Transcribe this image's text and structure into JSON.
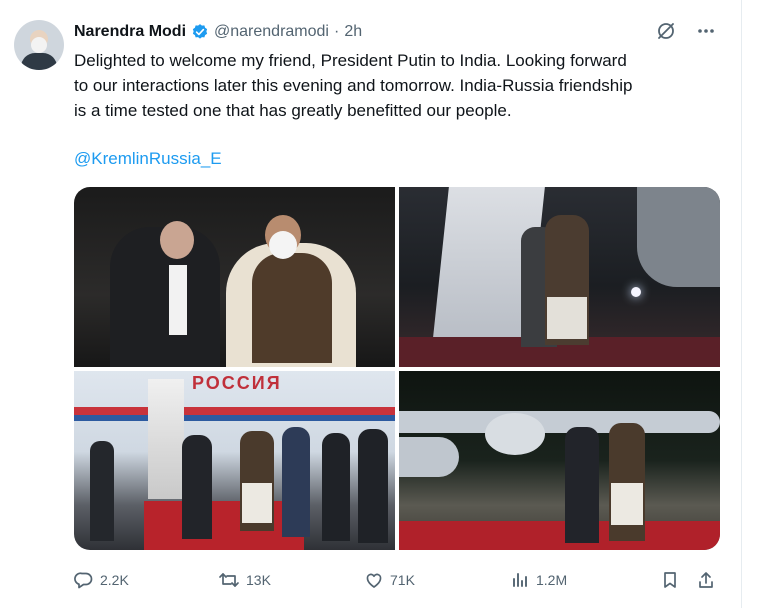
{
  "tweet": {
    "author_name": "Narendra Modi",
    "handle": "@narendramodi",
    "separator": "·",
    "time": "2h",
    "text": "Delighted to welcome my friend, President Putin to India. Looking forward\nto our interactions later this evening and tomorrow. India-Russia friendship\nis a time tested one that has greatly benefitted our people.",
    "mention": "@KremlinRussia_E"
  },
  "media": {
    "photo3_sign": "РОССИЯ"
  },
  "actions": {
    "replies": "2.2K",
    "reposts": "13K",
    "likes": "71K",
    "views": "1.2M"
  },
  "icons": {
    "verified": "verified-badge-icon",
    "grok": "grok-icon",
    "more": "more-icon",
    "reply": "reply-icon",
    "repost": "repost-icon",
    "like": "like-icon",
    "views": "views-icon",
    "bookmark": "bookmark-icon",
    "share": "share-icon"
  },
  "colors": {
    "accent": "#1d9bf0",
    "text": "#0f1419",
    "muted": "#536471"
  }
}
